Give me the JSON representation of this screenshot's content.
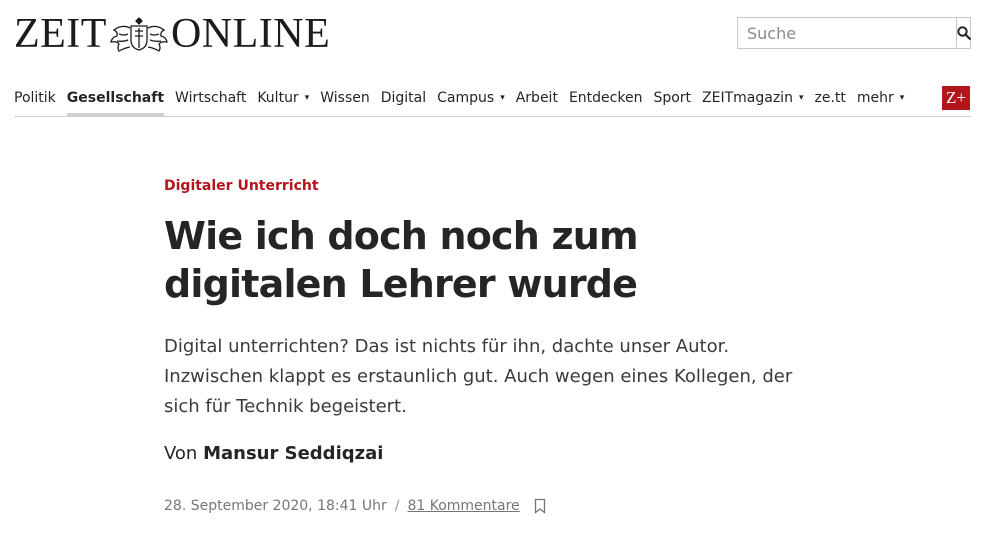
{
  "brand": {
    "logo_left": "ZEIT",
    "logo_right": "ONLINE",
    "emblem": "eagle-crest-icon"
  },
  "search": {
    "placeholder": "Suche",
    "icon": "search-icon"
  },
  "nav": {
    "items": [
      {
        "label": "Politik",
        "active": false,
        "dropdown": false
      },
      {
        "label": "Gesellschaft",
        "active": true,
        "dropdown": false
      },
      {
        "label": "Wirtschaft",
        "active": false,
        "dropdown": false
      },
      {
        "label": "Kultur",
        "active": false,
        "dropdown": true
      },
      {
        "label": "Wissen",
        "active": false,
        "dropdown": false
      },
      {
        "label": "Digital",
        "active": false,
        "dropdown": false
      },
      {
        "label": "Campus",
        "active": false,
        "dropdown": true
      },
      {
        "label": "Arbeit",
        "active": false,
        "dropdown": false
      },
      {
        "label": "Entdecken",
        "active": false,
        "dropdown": false
      },
      {
        "label": "Sport",
        "active": false,
        "dropdown": false
      },
      {
        "label": "ZEITmagazin",
        "active": false,
        "dropdown": true
      },
      {
        "label": "ze.tt",
        "active": false,
        "dropdown": false
      },
      {
        "label": "mehr",
        "active": false,
        "dropdown": true
      }
    ],
    "zplus_label": "Z+",
    "caret": "▾"
  },
  "article": {
    "kicker": "Digitaler Unterricht",
    "title": "Wie ich doch noch zum digitalen Lehrer wurde",
    "summary": "Digital unterrichten? Das ist nichts für ihn, dachte unser Autor. Inzwischen klappt es erstaunlich gut. Auch wegen eines Kollegen, der sich für Technik begeistert.",
    "byline_prefix": "Von",
    "author": "Mansur Seddiqzai",
    "date": "28. September 2020, 18:41 Uhr",
    "separator": "/",
    "comments": "81 Kommentare",
    "bookmark_icon": "bookmark-icon"
  },
  "colors": {
    "accent": "#b3151d",
    "text": "#252525",
    "muted": "#767676"
  }
}
